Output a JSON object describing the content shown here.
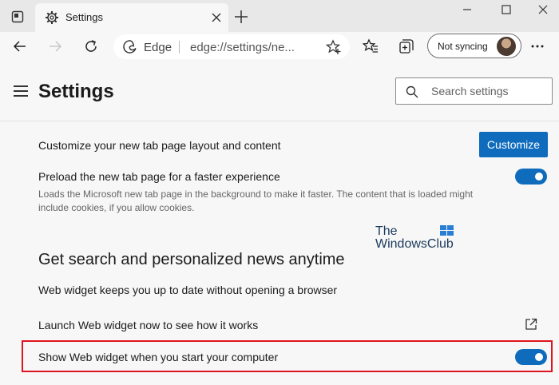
{
  "browser": {
    "tab_title": "Settings",
    "address": {
      "brand": "Edge",
      "url": "edge://settings/ne..."
    },
    "profile_label": "Not syncing"
  },
  "settings": {
    "title": "Settings",
    "search_placeholder": "Search settings",
    "customize": {
      "label": "Customize your new tab page layout and content",
      "button": "Customize"
    },
    "preload": {
      "label": "Preload the new tab page for a faster experience",
      "description_line1": "Loads the Microsoft new tab page in the background to make it faster. The content that is loaded might",
      "description_line2": "include cookies, if you allow cookies.",
      "enabled": true
    },
    "section_title": "Get search and personalized news anytime",
    "section_description": "Web widget keeps you up to date without opening a browser",
    "launch_widget": {
      "label": "Launch Web widget now to see how it works"
    },
    "show_widget": {
      "label": "Show Web widget when you start your computer",
      "enabled": true
    }
  },
  "watermark": {
    "line1": "The",
    "line2": "WindowsClub"
  },
  "colors": {
    "accent": "#0f6cbd",
    "highlight_border": "#e0141e",
    "background": "#f7f7f7",
    "tab_strip": "#e8e8e8"
  },
  "icons": {
    "tab_actions": "tab-actions-icon",
    "settings_favicon": "gear-icon",
    "back": "back-arrow-icon",
    "forward": "forward-arrow-icon",
    "refresh": "refresh-icon",
    "favorites": "favorites-icon",
    "collections": "collections-icon",
    "more": "more-icon",
    "search": "search-icon",
    "external": "external-link-icon"
  }
}
